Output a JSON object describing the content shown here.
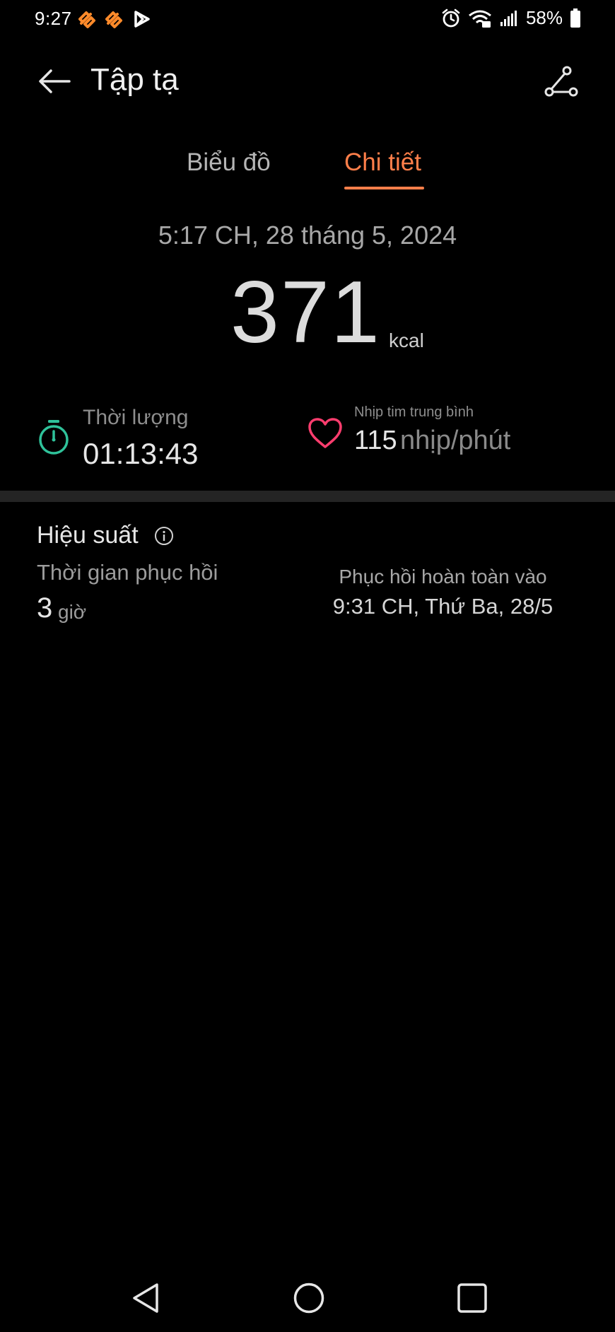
{
  "status_bar": {
    "time": "9:27",
    "battery": "58%",
    "icons": [
      "app-notification-icon",
      "app-notification-icon",
      "play-store-icon",
      "alarm-icon",
      "wifi-icon",
      "signal-icon",
      "battery-icon"
    ]
  },
  "header": {
    "title": "Tập tạ",
    "back_icon": "back-arrow-icon",
    "route_icon": "route-icon"
  },
  "tabs": [
    {
      "label": "Biểu đồ",
      "active": false
    },
    {
      "label": "Chi tiết",
      "active": true
    }
  ],
  "summary": {
    "datetime": "5:17 CH, 28 tháng 5, 2024",
    "calories": "371",
    "calories_unit": "kcal"
  },
  "metrics": {
    "duration": {
      "label": "Thời lượng",
      "value": "01:13:43",
      "icon": "stopwatch-icon"
    },
    "heart_rate": {
      "label": "Nhịp tim trung bình",
      "value": "115",
      "unit": "nhịp/phút",
      "icon": "heart-icon"
    }
  },
  "performance": {
    "title": "Hiệu suất",
    "info_icon": "info-icon",
    "recovery_label": "Thời gian phục hồi",
    "recovery_value": "3",
    "recovery_unit": "giờ",
    "full_recovery_label": "Phục hồi hoàn toàn vào",
    "full_recovery_value": "9:31 CH, Thứ Ba, 28/5"
  },
  "colors": {
    "accent": "#ff7f4a",
    "stopwatch": "#2fc29a",
    "heart": "#ff3d6e",
    "background": "#000000",
    "divider": "#242424"
  },
  "navigation": [
    "back-triangle-icon",
    "home-circle-icon",
    "recents-square-icon"
  ]
}
